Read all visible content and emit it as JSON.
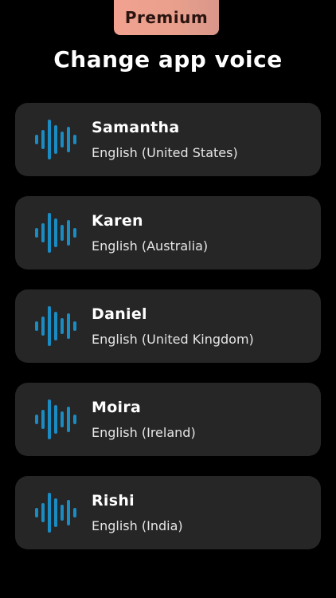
{
  "header": {
    "premium_label": "Premium",
    "title": "Change app voice"
  },
  "colors": {
    "background": "#000000",
    "card": "#262626",
    "wave_icon": "#1a8cc4",
    "premium_gradient_start": "#f2a190",
    "premium_gradient_end": "#d9968a"
  },
  "icons": {
    "voice_icon": "sound-wave-icon"
  },
  "voices": [
    {
      "name": "Samantha",
      "language": "English (United States)"
    },
    {
      "name": "Karen",
      "language": "English (Australia)"
    },
    {
      "name": "Daniel",
      "language": "English (United Kingdom)"
    },
    {
      "name": "Moira",
      "language": "English (Ireland)"
    },
    {
      "name": "Rishi",
      "language": "English (India)"
    }
  ]
}
